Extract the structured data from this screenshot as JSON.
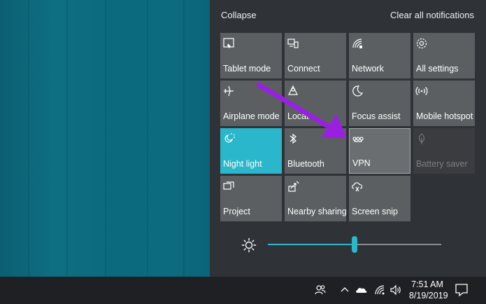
{
  "header": {
    "collapse_label": "Collapse",
    "clear_label": "Clear all notifications"
  },
  "tiles": [
    {
      "label": "Tablet mode",
      "icon": "tablet-mode-icon",
      "state": "off"
    },
    {
      "label": "Connect",
      "icon": "connect-icon",
      "state": "off"
    },
    {
      "label": "Network",
      "icon": "network-icon",
      "state": "off"
    },
    {
      "label": "All settings",
      "icon": "gear-icon",
      "state": "off"
    },
    {
      "label": "Airplane mode",
      "icon": "airplane-icon",
      "state": "off"
    },
    {
      "label": "Locat",
      "icon": "location-icon",
      "state": "off"
    },
    {
      "label": "Focus assist",
      "icon": "moon-icon",
      "state": "off"
    },
    {
      "label": "Mobile hotspot",
      "icon": "hotspot-icon",
      "state": "off"
    },
    {
      "label": "Night light",
      "icon": "night-light-icon",
      "state": "on"
    },
    {
      "label": "Bluetooth",
      "icon": "bluetooth-icon",
      "state": "off"
    },
    {
      "label": "VPN",
      "icon": "vpn-icon",
      "state": "hover"
    },
    {
      "label": "Battery saver",
      "icon": "battery-saver-icon",
      "state": "disabled"
    },
    {
      "label": "Project",
      "icon": "project-icon",
      "state": "off"
    },
    {
      "label": "Nearby sharing",
      "icon": "nearby-sharing-icon",
      "state": "off"
    },
    {
      "label": "Screen snip",
      "icon": "screen-snip-icon",
      "state": "off"
    }
  ],
  "brightness": {
    "icon": "brightness-icon",
    "level": 0.5
  },
  "taskbar": {
    "time": "7:51 AM",
    "date": "8/19/2019",
    "tray_icons": [
      "people-icon",
      "chevron-up-icon",
      "onedrive-icon",
      "wifi-icon",
      "volume-icon"
    ],
    "notification_icon": "action-center-icon"
  },
  "colors": {
    "accent": "#2ab7cb",
    "tile": "#5c5f62",
    "panel": "#2f3237",
    "annotation_arrow": "#9b1fe3"
  }
}
